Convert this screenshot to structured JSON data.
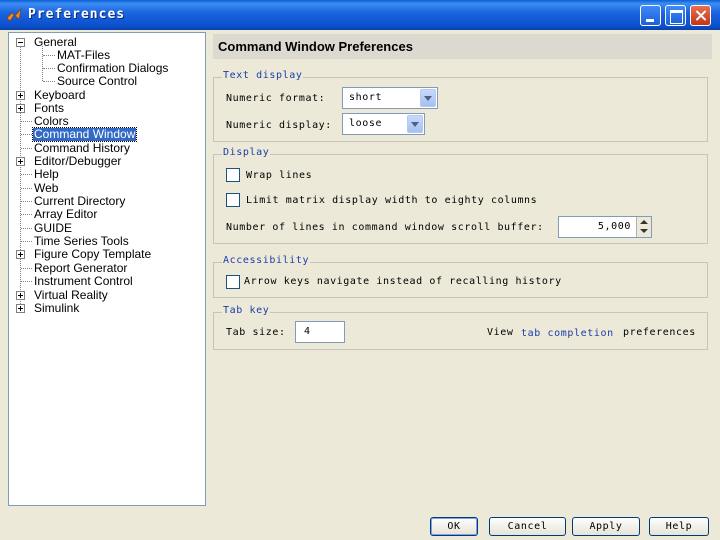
{
  "window": {
    "title": "Preferences"
  },
  "tree": {
    "items": [
      {
        "label": "General",
        "expander": "minus"
      },
      {
        "label": "MAT-Files"
      },
      {
        "label": "Confirmation Dialogs"
      },
      {
        "label": "Source Control"
      },
      {
        "label": "Keyboard",
        "expander": "plus"
      },
      {
        "label": "Fonts",
        "expander": "plus"
      },
      {
        "label": "Colors"
      },
      {
        "label": "Command Window",
        "selected": true
      },
      {
        "label": "Command History"
      },
      {
        "label": "Editor/Debugger",
        "expander": "plus"
      },
      {
        "label": "Help"
      },
      {
        "label": "Web"
      },
      {
        "label": "Current Directory"
      },
      {
        "label": "Array Editor"
      },
      {
        "label": "GUIDE"
      },
      {
        "label": "Time Series Tools"
      },
      {
        "label": "Figure Copy Template",
        "expander": "plus"
      },
      {
        "label": "Report Generator"
      },
      {
        "label": "Instrument Control"
      },
      {
        "label": "Virtual Reality",
        "expander": "plus"
      },
      {
        "label": "Simulink",
        "expander": "plus"
      }
    ]
  },
  "main": {
    "header": "Command Window Preferences",
    "text_display": {
      "title": "Text display",
      "numeric_format_label": "Numeric format:",
      "numeric_format_value": "short",
      "numeric_display_label": "Numeric display:",
      "numeric_display_value": "loose"
    },
    "display": {
      "title": "Display",
      "wrap_lines": "Wrap lines",
      "limit_width": "Limit matrix display width to eighty columns",
      "scroll_buffer_label": "Number of lines in command window scroll buffer:",
      "scroll_buffer_value": "5,000"
    },
    "accessibility": {
      "title": "Accessibility",
      "arrow_keys": "Arrow keys navigate instead of recalling history"
    },
    "tab_key": {
      "title": "Tab key",
      "tab_size_label": "Tab size:",
      "tab_size_value": "4",
      "view_prefix": "View",
      "tab_completion_link": "tab completion",
      "view_suffix": "preferences"
    }
  },
  "buttons": {
    "ok": "OK",
    "cancel": "Cancel",
    "apply": "Apply",
    "help": "Help"
  },
  "colors": {
    "titlebar": "#0a4ecb",
    "selection": "#316ac5",
    "group_title": "#1a3ea8",
    "background": "#ece9d8"
  }
}
